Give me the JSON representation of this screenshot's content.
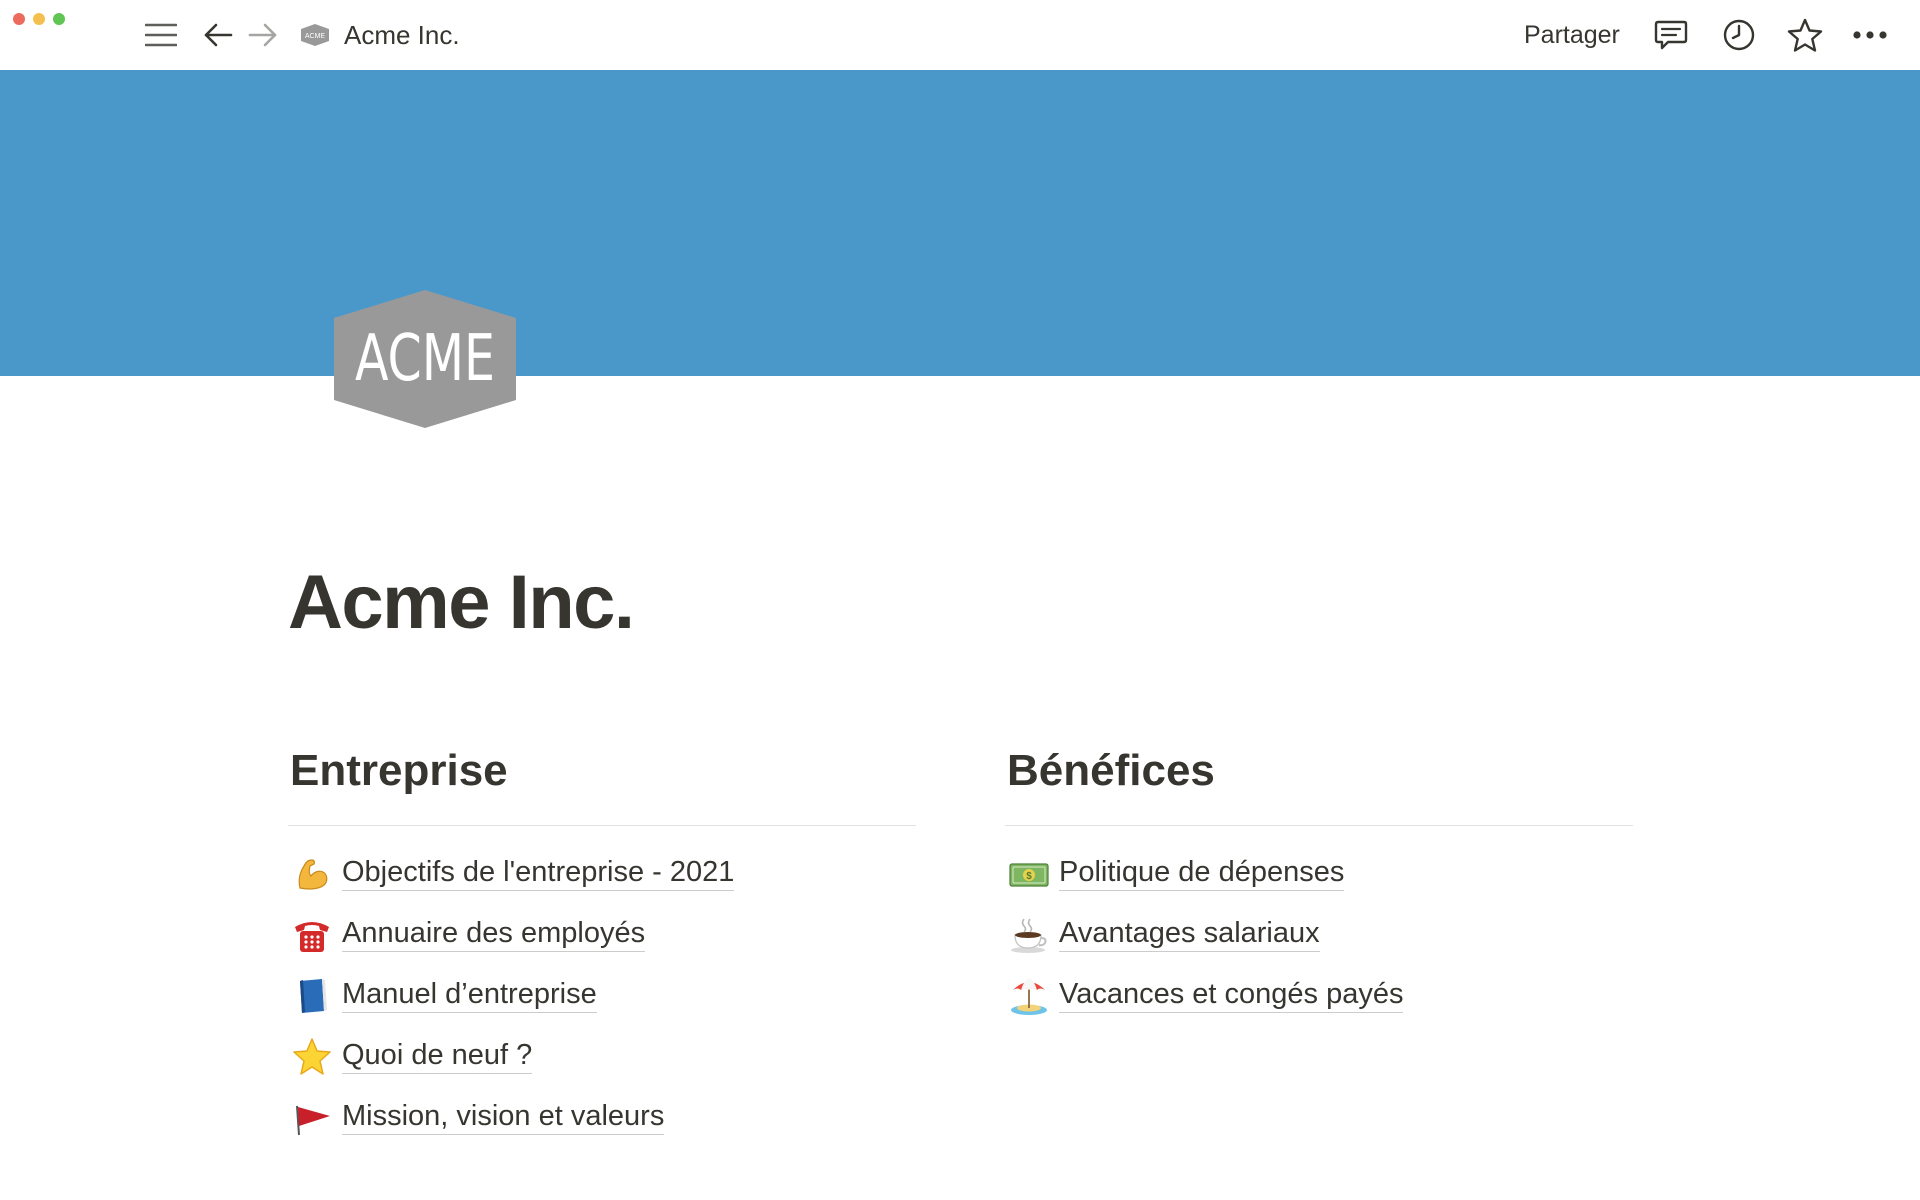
{
  "window": {
    "colors": {
      "close": "#ed6a5e",
      "minimize": "#f5bf4f",
      "zoom": "#61c554"
    }
  },
  "topbar": {
    "breadcrumb_title": "Acme Inc.",
    "breadcrumb_logo_text": "ACME",
    "share_label": "Partager",
    "icons": [
      "sidebar-menu-icon",
      "back-arrow-icon",
      "forward-arrow-icon",
      "comments-icon",
      "history-clock-icon",
      "favorite-star-icon",
      "more-dots-icon"
    ]
  },
  "cover": {
    "color": "#4a98c9"
  },
  "page": {
    "icon_text": "ACME",
    "icon_color": "#999999",
    "title": "Acme Inc."
  },
  "sections": {
    "left": {
      "heading": "Entreprise",
      "items": [
        {
          "emoji": "💪",
          "label": "Objectifs de l'entreprise - 2021"
        },
        {
          "emoji": "☎️",
          "label": "Annuaire des employés"
        },
        {
          "emoji": "📘",
          "label": "Manuel d’entreprise"
        },
        {
          "emoji": "⭐",
          "label": "Quoi de neuf ?"
        },
        {
          "emoji": "🚩",
          "label": "Mission, vision et valeurs"
        }
      ]
    },
    "right": {
      "heading": "Bénéfices",
      "items": [
        {
          "emoji": "💵",
          "label": "Politique de dépenses"
        },
        {
          "emoji": "☕",
          "label": "Avantages salariaux"
        },
        {
          "emoji": "🏖️",
          "label": "Vacances et congés payés"
        }
      ]
    }
  }
}
